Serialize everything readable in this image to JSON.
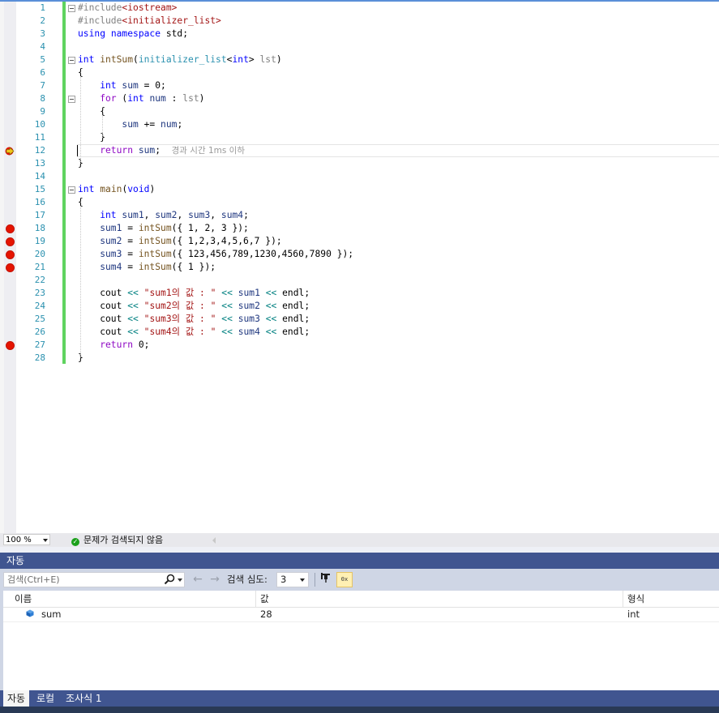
{
  "editor": {
    "lines": [
      {
        "num": "1",
        "tokens": [
          {
            "t": "#include",
            "c": "pp"
          },
          {
            "t": "<iostream>",
            "c": "str"
          }
        ]
      },
      {
        "num": "2",
        "tokens": [
          {
            "t": "#include",
            "c": "pp"
          },
          {
            "t": "<initializer_list>",
            "c": "str"
          }
        ]
      },
      {
        "num": "3",
        "tokens": [
          {
            "t": "using ",
            "c": "kw"
          },
          {
            "t": "namespace ",
            "c": "kw"
          },
          {
            "t": "std;",
            "c": ""
          }
        ]
      },
      {
        "num": "4",
        "tokens": []
      },
      {
        "num": "5",
        "tokens": [
          {
            "t": "int ",
            "c": "kw"
          },
          {
            "t": "intSum",
            "c": "fn"
          },
          {
            "t": "(",
            "c": ""
          },
          {
            "t": "initializer_list",
            "c": "type"
          },
          {
            "t": "<",
            "c": ""
          },
          {
            "t": "int",
            "c": "kw"
          },
          {
            "t": "> ",
            "c": ""
          },
          {
            "t": "lst",
            "c": "param"
          },
          {
            "t": ")",
            "c": ""
          }
        ]
      },
      {
        "num": "6",
        "tokens": [
          {
            "t": "{",
            "c": ""
          }
        ]
      },
      {
        "num": "7",
        "tokens": [
          {
            "t": "    int ",
            "c": "kw"
          },
          {
            "t": "sum",
            "c": "var"
          },
          {
            "t": " = 0;",
            "c": ""
          }
        ]
      },
      {
        "num": "8",
        "tokens": [
          {
            "t": "    for ",
            "c": "ctl"
          },
          {
            "t": "(",
            "c": ""
          },
          {
            "t": "int ",
            "c": "kw"
          },
          {
            "t": "num",
            "c": "var"
          },
          {
            "t": " : ",
            "c": ""
          },
          {
            "t": "lst",
            "c": "param"
          },
          {
            "t": ")",
            "c": ""
          }
        ]
      },
      {
        "num": "9",
        "tokens": [
          {
            "t": "    {",
            "c": ""
          }
        ]
      },
      {
        "num": "10",
        "tokens": [
          {
            "t": "        sum",
            "c": "var"
          },
          {
            "t": " += ",
            "c": ""
          },
          {
            "t": "num",
            "c": "var"
          },
          {
            "t": ";",
            "c": ""
          }
        ]
      },
      {
        "num": "11",
        "tokens": [
          {
            "t": "    }",
            "c": ""
          }
        ]
      },
      {
        "num": "12",
        "tokens": [
          {
            "t": "    return ",
            "c": "ctl"
          },
          {
            "t": "sum",
            "c": "var"
          },
          {
            "t": ";  ",
            "c": ""
          },
          {
            "t": "경과 시간 1ms 이하",
            "c": "hint"
          }
        ]
      },
      {
        "num": "13",
        "tokens": [
          {
            "t": "}",
            "c": ""
          }
        ]
      },
      {
        "num": "14",
        "tokens": []
      },
      {
        "num": "15",
        "tokens": [
          {
            "t": "int ",
            "c": "kw"
          },
          {
            "t": "main",
            "c": "fn"
          },
          {
            "t": "(",
            "c": ""
          },
          {
            "t": "void",
            "c": "kw"
          },
          {
            "t": ")",
            "c": ""
          }
        ]
      },
      {
        "num": "16",
        "tokens": [
          {
            "t": "{",
            "c": ""
          }
        ]
      },
      {
        "num": "17",
        "tokens": [
          {
            "t": "    int ",
            "c": "kw"
          },
          {
            "t": "sum1",
            "c": "var"
          },
          {
            "t": ", ",
            "c": ""
          },
          {
            "t": "sum2",
            "c": "var"
          },
          {
            "t": ", ",
            "c": ""
          },
          {
            "t": "sum3",
            "c": "var"
          },
          {
            "t": ", ",
            "c": ""
          },
          {
            "t": "sum4",
            "c": "var"
          },
          {
            "t": ";",
            "c": ""
          }
        ]
      },
      {
        "num": "18",
        "tokens": [
          {
            "t": "    sum1",
            "c": "var"
          },
          {
            "t": " = ",
            "c": ""
          },
          {
            "t": "intSum",
            "c": "fn"
          },
          {
            "t": "({ 1, 2, 3 });",
            "c": ""
          }
        ]
      },
      {
        "num": "19",
        "tokens": [
          {
            "t": "    sum2",
            "c": "var"
          },
          {
            "t": " = ",
            "c": ""
          },
          {
            "t": "intSum",
            "c": "fn"
          },
          {
            "t": "({ 1,2,3,4,5,6,7 });",
            "c": ""
          }
        ]
      },
      {
        "num": "20",
        "tokens": [
          {
            "t": "    sum3",
            "c": "var"
          },
          {
            "t": " = ",
            "c": ""
          },
          {
            "t": "intSum",
            "c": "fn"
          },
          {
            "t": "({ 123,456,789,1230,4560,7890 });",
            "c": ""
          }
        ]
      },
      {
        "num": "21",
        "tokens": [
          {
            "t": "    sum4",
            "c": "var"
          },
          {
            "t": " = ",
            "c": ""
          },
          {
            "t": "intSum",
            "c": "fn"
          },
          {
            "t": "({ 1 });",
            "c": ""
          }
        ]
      },
      {
        "num": "22",
        "tokens": []
      },
      {
        "num": "23",
        "tokens": [
          {
            "t": "    cout ",
            "c": ""
          },
          {
            "t": "<<",
            "c": "op"
          },
          {
            "t": " ",
            "c": ""
          },
          {
            "t": "\"sum1의 값 : \"",
            "c": "str"
          },
          {
            "t": " ",
            "c": ""
          },
          {
            "t": "<<",
            "c": "op"
          },
          {
            "t": " ",
            "c": ""
          },
          {
            "t": "sum1",
            "c": "var"
          },
          {
            "t": " ",
            "c": ""
          },
          {
            "t": "<<",
            "c": "op"
          },
          {
            "t": " endl;",
            "c": ""
          }
        ]
      },
      {
        "num": "24",
        "tokens": [
          {
            "t": "    cout ",
            "c": ""
          },
          {
            "t": "<<",
            "c": "op"
          },
          {
            "t": " ",
            "c": ""
          },
          {
            "t": "\"sum2의 값 : \"",
            "c": "str"
          },
          {
            "t": " ",
            "c": ""
          },
          {
            "t": "<<",
            "c": "op"
          },
          {
            "t": " ",
            "c": ""
          },
          {
            "t": "sum2",
            "c": "var"
          },
          {
            "t": " ",
            "c": ""
          },
          {
            "t": "<<",
            "c": "op"
          },
          {
            "t": " endl;",
            "c": ""
          }
        ]
      },
      {
        "num": "25",
        "tokens": [
          {
            "t": "    cout ",
            "c": ""
          },
          {
            "t": "<<",
            "c": "op"
          },
          {
            "t": " ",
            "c": ""
          },
          {
            "t": "\"sum3의 값 : \"",
            "c": "str"
          },
          {
            "t": " ",
            "c": ""
          },
          {
            "t": "<<",
            "c": "op"
          },
          {
            "t": " ",
            "c": ""
          },
          {
            "t": "sum3",
            "c": "var"
          },
          {
            "t": " ",
            "c": ""
          },
          {
            "t": "<<",
            "c": "op"
          },
          {
            "t": " endl;",
            "c": ""
          }
        ]
      },
      {
        "num": "26",
        "tokens": [
          {
            "t": "    cout ",
            "c": ""
          },
          {
            "t": "<<",
            "c": "op"
          },
          {
            "t": " ",
            "c": ""
          },
          {
            "t": "\"sum4의 값 : \"",
            "c": "str"
          },
          {
            "t": " ",
            "c": ""
          },
          {
            "t": "<<",
            "c": "op"
          },
          {
            "t": " ",
            "c": ""
          },
          {
            "t": "sum4",
            "c": "var"
          },
          {
            "t": " ",
            "c": ""
          },
          {
            "t": "<<",
            "c": "op"
          },
          {
            "t": " endl;",
            "c": ""
          }
        ]
      },
      {
        "num": "27",
        "tokens": [
          {
            "t": "    return ",
            "c": "ctl"
          },
          {
            "t": "0;",
            "c": ""
          }
        ]
      },
      {
        "num": "28",
        "tokens": [
          {
            "t": "}",
            "c": ""
          }
        ]
      }
    ],
    "breakpoint_lines": [
      "18",
      "19",
      "20",
      "21",
      "27"
    ],
    "current_line": "12",
    "fold_lines": [
      "1",
      "5",
      "8",
      "15"
    ]
  },
  "status": {
    "zoom": "100 %",
    "issues_text": "문제가 검색되지 않음"
  },
  "autos": {
    "title": "자동",
    "search_placeholder": "검색(Ctrl+E)",
    "depth_label": "검색 심도:",
    "depth_value": "3",
    "columns": {
      "name": "이름",
      "value": "값",
      "type": "형식"
    },
    "rows": [
      {
        "name": "sum",
        "value": "28",
        "type": "int"
      }
    ]
  },
  "tabs": [
    {
      "label": "자동",
      "active": true
    },
    {
      "label": "로컬",
      "active": false
    },
    {
      "label": "조사식 1",
      "active": false
    }
  ],
  "colors": {
    "breakpoint": "#e51400",
    "current_line_arrow": "#f0c419",
    "tool_window_title": "#405590",
    "change_bar": "#5fd35f"
  }
}
